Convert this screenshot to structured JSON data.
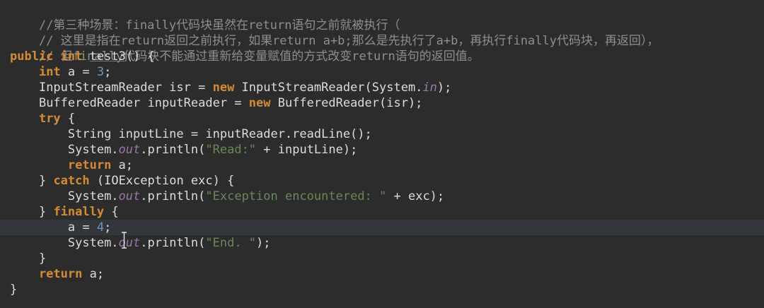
{
  "code": {
    "comment1": "//第三种场景：finally代码块虽然在return语句之前就被执行（",
    "comment2": "// 这里是指在return返回之前执行，如果return a+b;那么是先执行了a+b，再执行finally代码块，再返回），",
    "comment3": "// 但finally代码块不能通过重新给变量赋值的方式改变return语句的返回值。",
    "l4": {
      "kw1": "public",
      "kw2": "int",
      "method": "test3",
      "rest": "() {"
    },
    "l5": {
      "kw": "int",
      "rest": " a = ",
      "num": "3",
      "end": ";"
    },
    "l6": {
      "a": "InputStreamReader isr = ",
      "kw": "new",
      "b": " InputStreamReader(System.",
      "fld": "in",
      "c": ");"
    },
    "l7": {
      "a": "BufferedReader inputReader = ",
      "kw": "new",
      "b": " BufferedReader(isr);"
    },
    "l8": {
      "kw": "try",
      "rest": " {"
    },
    "l9": {
      "a": "String inputLine = inputReader.readLine();"
    },
    "l10": {
      "a": "System.",
      "fld": "out",
      "b": ".println(",
      "str": "\"Read:\"",
      "c": " + inputLine);"
    },
    "l11": {
      "kw": "return",
      "rest": " a;"
    },
    "l12": {
      "a": "} ",
      "kw": "catch",
      "b": " (IOException exc) {"
    },
    "l13": {
      "a": "System.",
      "fld": "out",
      "b": ".println(",
      "str": "\"Exception encountered: \"",
      "c": " + exc);"
    },
    "l14": {
      "a": "} ",
      "kw": "finally",
      "b": " {"
    },
    "l15": {
      "a": "a = ",
      "num": "4",
      "end": ";"
    },
    "l16": {
      "a": "System.",
      "fld": "out",
      "b": ".println(",
      "str": "\"End. \"",
      "c": ");"
    },
    "l17": {
      "a": "}"
    },
    "l18": {
      "kw": "return",
      "rest": " a;"
    },
    "l19": {
      "a": "}"
    }
  },
  "colors": {
    "background": "#2c2c2c",
    "keyword": "#d58b34",
    "comment": "#8e8e8e",
    "string": "#6a8759",
    "number": "#6897bb",
    "field": "#9876aa"
  },
  "icons": {
    "mouse_cursor": "text-ibeam-cursor-icon"
  }
}
